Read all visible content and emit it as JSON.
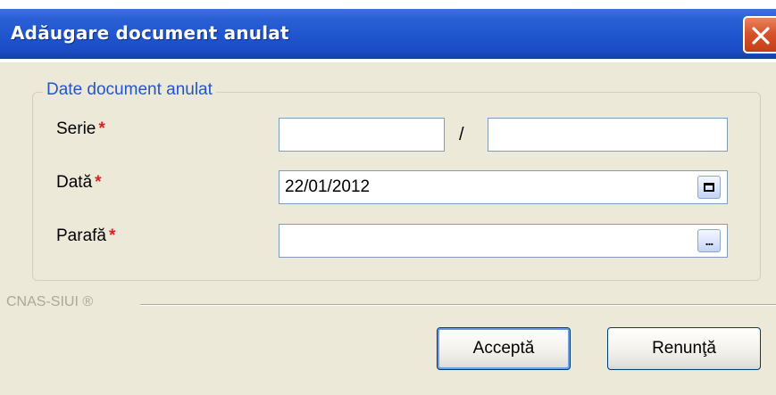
{
  "window": {
    "title": "Adăugare document anulat",
    "colors": {
      "titlebar": "#1F55CF",
      "close_button": "#D9542C",
      "dialog_background": "#ECE9D8",
      "legend_text": "#2255CC",
      "required_marker": "#E02020"
    }
  },
  "group": {
    "legend": "Date document anulat"
  },
  "fields": {
    "serie": {
      "label": "Serie",
      "required_marker": "*",
      "value_part1": "",
      "separator": "/",
      "value_part2": ""
    },
    "data": {
      "label": "Dată",
      "required_marker": "*",
      "value": "22/01/2012",
      "button_icon": "calendar-icon"
    },
    "parafa": {
      "label": "Parafă",
      "required_marker": "*",
      "value": "",
      "button_icon": "ellipsis-icon",
      "button_text": "..."
    }
  },
  "footer": {
    "brand": "CNAS-SIUI ®"
  },
  "buttons": {
    "accept": "Acceptă",
    "cancel": "Renunţă"
  }
}
